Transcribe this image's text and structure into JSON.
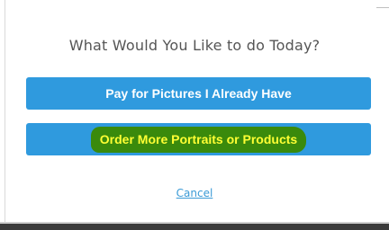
{
  "dialog": {
    "title": "What Would You Like to do Today?",
    "buttons": {
      "pay_label": "Pay for Pictures I Already Have",
      "order_label": "Order More Portraits or Products"
    },
    "cancel_label": "Cancel"
  },
  "colors": {
    "button_bg": "#2f9ade",
    "button_text": "#ffffff",
    "highlight_bg": "#3a8a0c",
    "highlight_text": "#ffff33",
    "title_text": "#555555",
    "link": "#3a9ad6"
  }
}
